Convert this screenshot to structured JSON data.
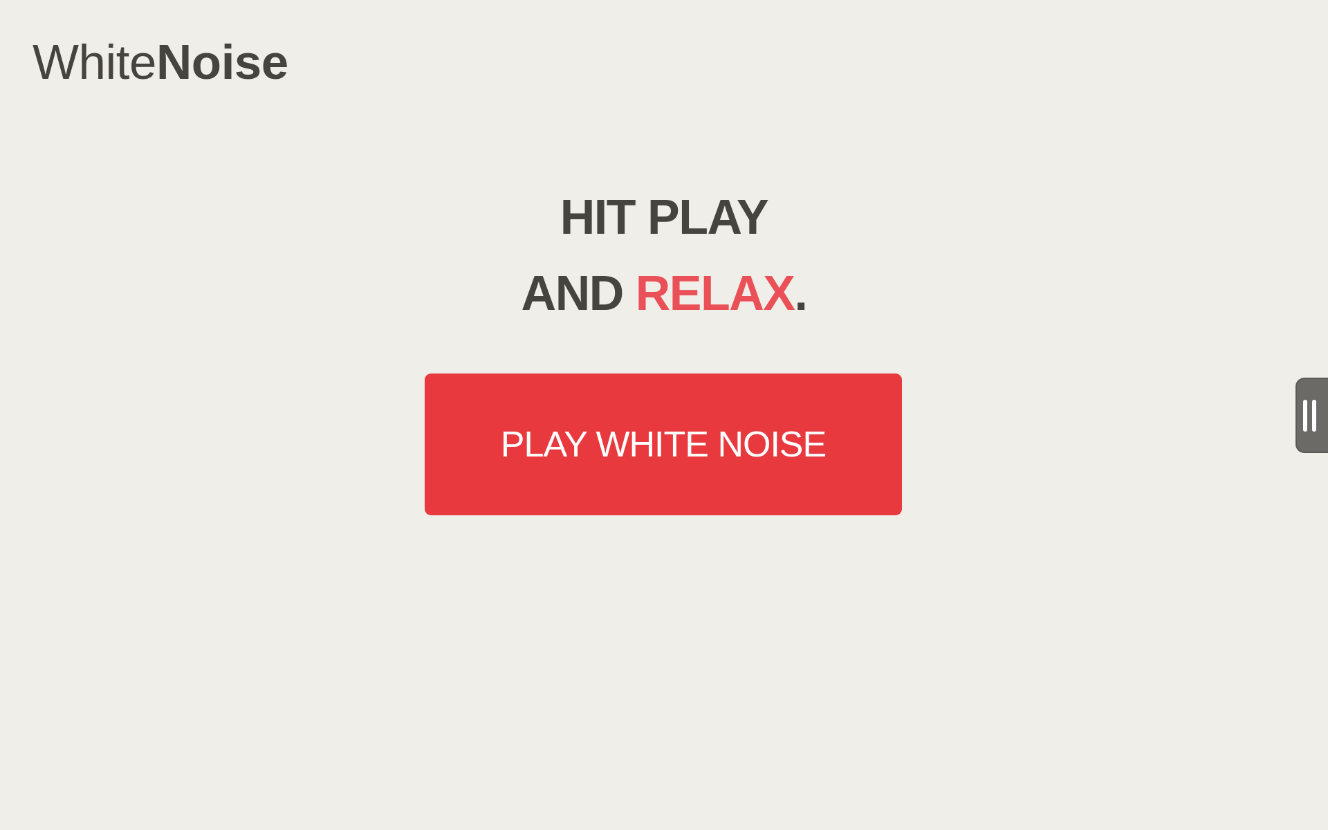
{
  "logo": "White**Noise**",
  "headline": {
    "lines": [
      [
        {
          "text": "HIT PLAY",
          "accent": false
        }
      ],
      [
        {
          "text": "AND ",
          "accent": false
        },
        {
          "text": "RELAX",
          "accent": true
        },
        {
          "text": ".",
          "accent": false
        }
      ]
    ]
  },
  "play_button": {
    "label": "PLAY WHITE NOISE"
  }
}
